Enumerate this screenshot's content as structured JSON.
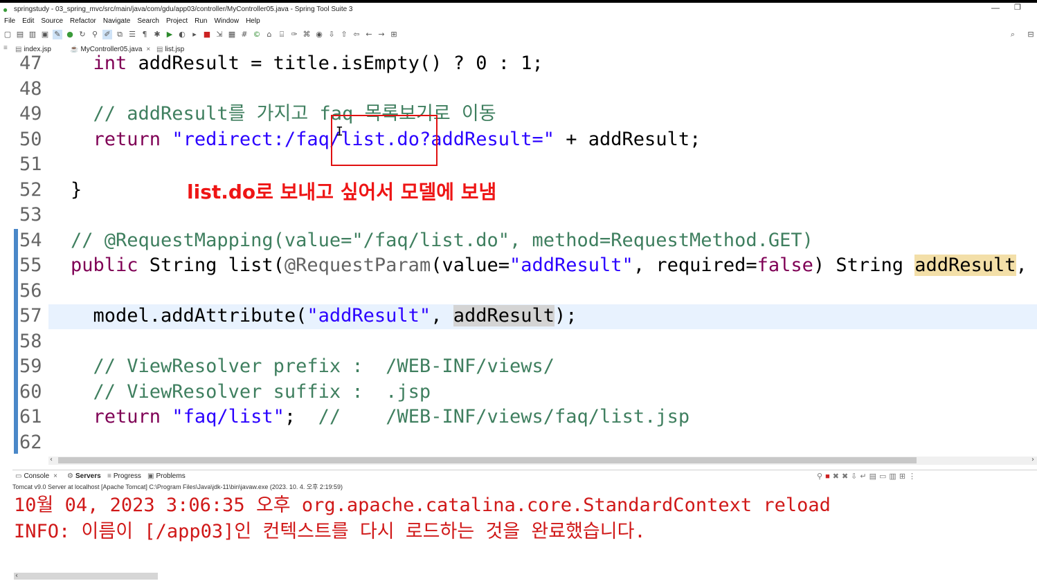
{
  "window": {
    "title": "springstudy - 03_spring_mvc/src/main/java/com/gdu/app03/controller/MyController05.java - Spring Tool Suite 3",
    "minimize": "—",
    "restore": "❐"
  },
  "menu": [
    "File",
    "Edit",
    "Source",
    "Refactor",
    "Navigate",
    "Search",
    "Project",
    "Run",
    "Window",
    "Help"
  ],
  "tabs": [
    {
      "label": "index.jsp",
      "icon": "jsp-file-icon"
    },
    {
      "label": "MyController05.java",
      "icon": "java-file-icon",
      "close": "×",
      "active": true
    },
    {
      "label": "list.jsp",
      "icon": "jsp-file-icon"
    }
  ],
  "editor": {
    "lines": [
      {
        "num": "47",
        "parts": [
          {
            "t": "  "
          },
          {
            "t": "int",
            "c": "kw"
          },
          {
            "t": " addResult = title.isEmpty() ? 0 : 1;"
          }
        ]
      },
      {
        "num": "48",
        "parts": []
      },
      {
        "num": "49",
        "parts": [
          {
            "t": "  "
          },
          {
            "t": "// addResult를 가지고 faq 목록보기로 이동",
            "c": "cmt"
          }
        ]
      },
      {
        "num": "50",
        "parts": [
          {
            "t": "  "
          },
          {
            "t": "return",
            "c": "kw"
          },
          {
            "t": " "
          },
          {
            "t": "\"redirect:/faq/list.do?addResult=\"",
            "c": "str"
          },
          {
            "t": " + addResult;"
          }
        ]
      },
      {
        "num": "51",
        "parts": []
      },
      {
        "num": "52",
        "parts": [
          {
            "t": "}"
          }
        ]
      },
      {
        "num": "53",
        "parts": []
      },
      {
        "num": "54",
        "parts": [
          {
            "t": "// @RequestMapping(value=\"/faq/list.do\", method=RequestMethod.GET)",
            "c": "cmt"
          }
        ]
      },
      {
        "num": "55",
        "parts": [
          {
            "t": "public",
            "c": "kw"
          },
          {
            "t": " String list("
          },
          {
            "t": "@RequestParam",
            "c": "ann"
          },
          {
            "t": "(value="
          },
          {
            "t": "\"addResult\"",
            "c": "str"
          },
          {
            "t": ", required="
          },
          {
            "t": "false",
            "c": "kw"
          },
          {
            "t": ") String "
          },
          {
            "t": "addResult",
            "c": "hl"
          },
          {
            "t": ", Mo"
          }
        ]
      },
      {
        "num": "56",
        "parts": []
      },
      {
        "num": "57",
        "parts": [
          {
            "t": "  model.addAttribute("
          },
          {
            "t": "\"addResult\"",
            "c": "str"
          },
          {
            "t": ", "
          },
          {
            "t": "addResult",
            "c": "hl2"
          },
          {
            "t": ");"
          }
        ]
      },
      {
        "num": "58",
        "parts": []
      },
      {
        "num": "59",
        "parts": [
          {
            "t": "  "
          },
          {
            "t": "// ViewResolver prefix :  /WEB-INF/views/",
            "c": "cmt"
          }
        ]
      },
      {
        "num": "60",
        "parts": [
          {
            "t": "  "
          },
          {
            "t": "// ViewResolver suffix :  .jsp",
            "c": "cmt"
          }
        ]
      },
      {
        "num": "61",
        "parts": [
          {
            "t": "  "
          },
          {
            "t": "return",
            "c": "kw"
          },
          {
            "t": " "
          },
          {
            "t": "\"faq/list\"",
            "c": "str"
          },
          {
            "t": ";  "
          },
          {
            "t": "//    /WEB-INF/views/faq/list.jsp",
            "c": "cmt"
          }
        ]
      },
      {
        "num": "62",
        "parts": []
      }
    ],
    "annotation": "list.do로 보내고 싶어서 모델에 보냄"
  },
  "console": {
    "tabs": [
      "Console",
      "Servers",
      "Progress",
      "Problems"
    ],
    "subtitle": "Tomcat v9.0 Server at localhost [Apache Tomcat] C:\\Program Files\\Java\\jdk-11\\bin\\javaw.exe  (2023. 10. 4. 오후 2:19:59)",
    "lines": [
      "10월 04, 2023 3:06:35 오후 org.apache.catalina.core.StandardContext reload",
      "INFO: 이름이 [/app03]인 컨텍스트를 다시 로드하는 것을 완료했습니다."
    ]
  },
  "colors": {
    "keyword": "#7f0055",
    "string": "#2a00ff",
    "comment": "#3f7f5f",
    "annotation_red": "#ee1515",
    "console_red": "#d01818"
  }
}
